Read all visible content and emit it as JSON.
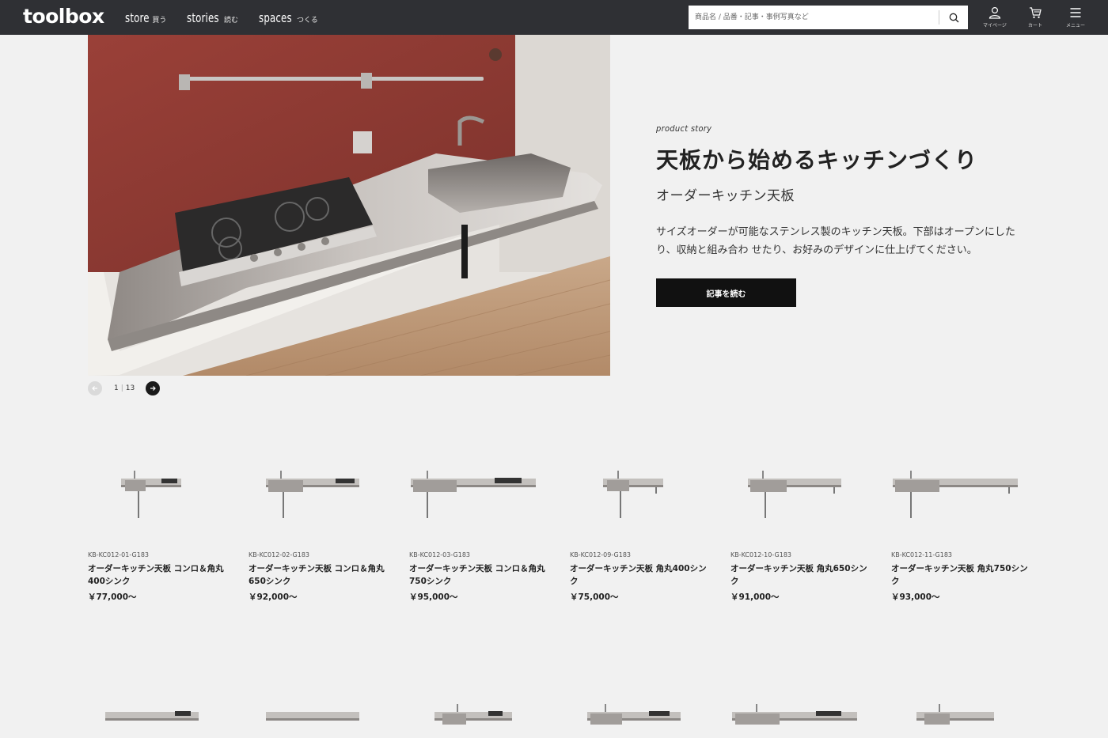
{
  "header": {
    "logo": "toolbox",
    "nav": [
      {
        "en": "store",
        "jp": "買う"
      },
      {
        "en": "stories",
        "jp": "読む"
      },
      {
        "en": "spaces",
        "jp": "つくる"
      }
    ],
    "search_placeholder": "商品名 / 品番・記事・事例写真など",
    "icons": [
      {
        "icon": "user-icon",
        "label": "マイページ"
      },
      {
        "icon": "cart-icon",
        "label": "カート"
      },
      {
        "icon": "menu-icon",
        "label": "メニュー"
      }
    ]
  },
  "hero": {
    "eyebrow": "product story",
    "title": "天板から始めるキッチンづくり",
    "subtitle": "オーダーキッチン天板",
    "description": "サイズオーダーが可能なステンレス製のキッチン天板。下部はオープンにしたり、収納と組み合わ せたり、お好みのデザインに仕上げてください。",
    "cta": "記事を読む",
    "pager": {
      "current": "1",
      "separator": "|",
      "total": "13"
    }
  },
  "products": [
    {
      "code": "KB-KC012-01-G183",
      "name": "オーダーキッチン天板 コンロ＆角丸400シンク",
      "price": "￥77,000〜"
    },
    {
      "code": "KB-KC012-02-G183",
      "name": "オーダーキッチン天板 コンロ＆角丸650シンク",
      "price": "￥92,000〜"
    },
    {
      "code": "KB-KC012-03-G183",
      "name": "オーダーキッチン天板 コンロ＆角丸750シンク",
      "price": "￥95,000〜"
    },
    {
      "code": "KB-KC012-09-G183",
      "name": "オーダーキッチン天板 角丸400シンク",
      "price": "￥75,000〜"
    },
    {
      "code": "KB-KC012-10-G183",
      "name": "オーダーキッチン天板 角丸650シンク",
      "price": "￥91,000〜"
    },
    {
      "code": "KB-KC012-11-G183",
      "name": "オーダーキッチン天板 角丸750シンク",
      "price": "￥93,000〜"
    }
  ],
  "colors": {
    "header_bg": "#2f3034",
    "page_bg": "#f1f1f1",
    "cta_bg": "#111111",
    "wall": "#8c3b33"
  }
}
